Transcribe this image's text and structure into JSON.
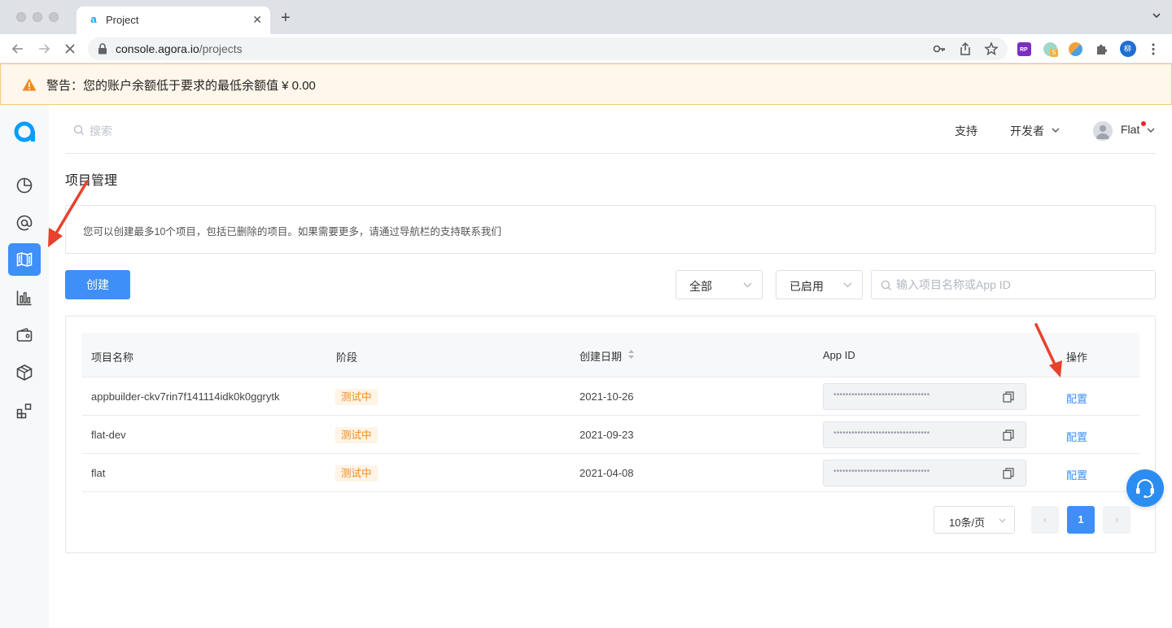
{
  "browser": {
    "tab_title": "Project",
    "tab_close": "✕",
    "new_tab": "+",
    "url_host": "console.agora.io",
    "url_path": "/projects",
    "extension_badge": "5",
    "profile_initial": "柳",
    "rp_label": "RP"
  },
  "warning": {
    "text": "警告：您的账户余额低于要求的最低余额值 ¥ 0.00"
  },
  "header": {
    "search_placeholder": "搜索",
    "support": "支持",
    "developer": "开发者",
    "user": "Flat"
  },
  "page": {
    "title": "项目管理",
    "notice": "您可以创建最多10个项目，包括已删除的项目。如果需要更多，请通过导航栏的支持联系我们"
  },
  "toolbar": {
    "create": "创建",
    "filter_all": "全部",
    "filter_status": "已启用",
    "search_placeholder": "输入项目名称或App ID"
  },
  "table": {
    "columns": [
      "项目名称",
      "阶段",
      "创建日期",
      "App ID",
      "操作"
    ],
    "rows": [
      {
        "name": "appbuilder-ckv7rin7f141114idk0k0ggrytk",
        "stage": "测试中",
        "date": "2021-10-26",
        "appid": "••••••••••••••••••••••••••••••••",
        "action": "配置"
      },
      {
        "name": "flat-dev",
        "stage": "测试中",
        "date": "2021-09-23",
        "appid": "••••••••••••••••••••••••••••••••",
        "action": "配置"
      },
      {
        "name": "flat",
        "stage": "测试中",
        "date": "2021-04-08",
        "appid": "••••••••••••••••••••••••••••••••",
        "action": "配置"
      }
    ]
  },
  "pagination": {
    "page_size": "10条/页",
    "prev": "‹",
    "current": "1",
    "next": "›"
  },
  "colors": {
    "accent": "#3e8ff7",
    "warning_bg": "#fff7ec",
    "warning_icon": "#f08a1c",
    "tag_text": "#f08a1c",
    "annotation_arrow": "#e8412c"
  },
  "icons": {
    "rail": [
      "agora-logo",
      "dashboard-icon",
      "at-icon",
      "projects-icon",
      "usage-chart-icon",
      "wallet-icon",
      "package-icon",
      "extensions-icon"
    ]
  }
}
